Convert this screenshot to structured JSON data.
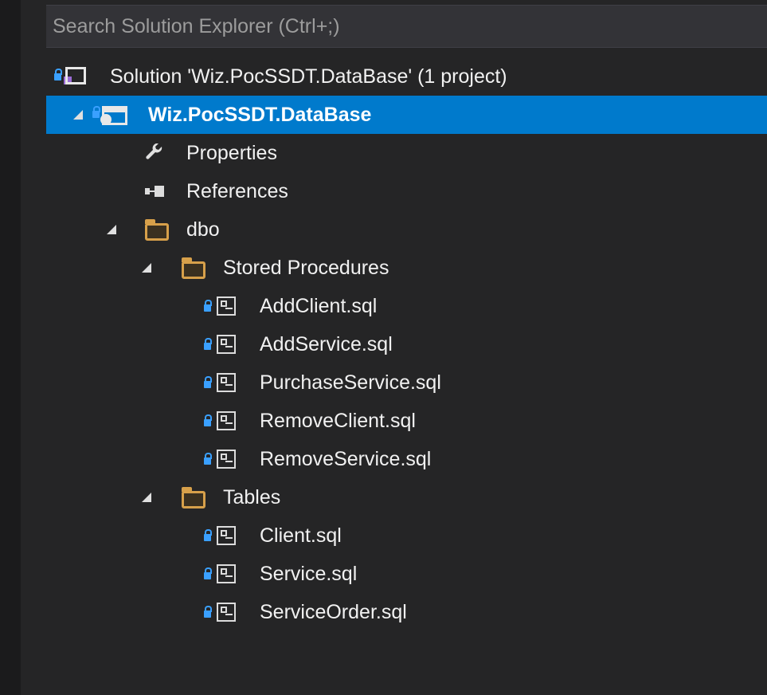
{
  "search": {
    "placeholder": "Search Solution Explorer (Ctrl+;)"
  },
  "tree": {
    "solution_label": "Solution 'Wiz.PocSSDT.DataBase' (1 project)",
    "project_label": "Wiz.PocSSDT.DataBase",
    "properties_label": "Properties",
    "references_label": "References",
    "dbo_folder": {
      "label": "dbo",
      "stored_procedures": {
        "label": "Stored Procedures",
        "files": [
          "AddClient.sql",
          "AddService.sql",
          "PurchaseService.sql",
          "RemoveClient.sql",
          "RemoveService.sql"
        ]
      },
      "tables": {
        "label": "Tables",
        "files": [
          "Client.sql",
          "Service.sql",
          "ServiceOrder.sql"
        ]
      }
    }
  },
  "colors": {
    "selection": "#007acc",
    "folder": "#d7a04a",
    "lock": "#3aa0ff",
    "background": "#252526"
  },
  "icons": {
    "solution": "solution-icon",
    "project": "database-project-icon",
    "properties": "wrench-icon",
    "references": "references-icon",
    "folder": "folder-icon",
    "sql_file": "sql-file-icon",
    "lock": "lock-icon",
    "expand": "expanded-arrow-icon"
  }
}
